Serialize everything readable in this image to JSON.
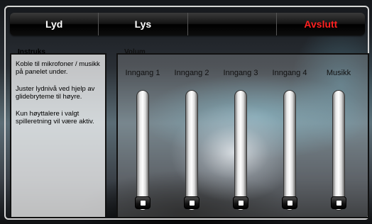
{
  "tabs": [
    {
      "label": "Lyd"
    },
    {
      "label": "Lys"
    },
    {
      "label": ""
    },
    {
      "label": "Avslutt"
    }
  ],
  "instructions": {
    "title": "Instruks",
    "paragraphs": [
      "Koble til mikrofoner / musikk på panelet under.",
      "Juster lydnivå ved hjelp av glidebryteme til høyre.",
      "Kun høyttalere i valgt spilleretning vil være aktiv."
    ]
  },
  "volume": {
    "title": "Volum",
    "channels": [
      {
        "label": "Inngang 1",
        "level": 0
      },
      {
        "label": "Inngang 2",
        "level": 0
      },
      {
        "label": "Inngang 3",
        "level": 0
      },
      {
        "label": "Inngang 4",
        "level": 0
      },
      {
        "label": "Musikk",
        "level": 0
      }
    ]
  },
  "colors": {
    "exit": "#ff2020",
    "tab_text": "#ffffff"
  }
}
